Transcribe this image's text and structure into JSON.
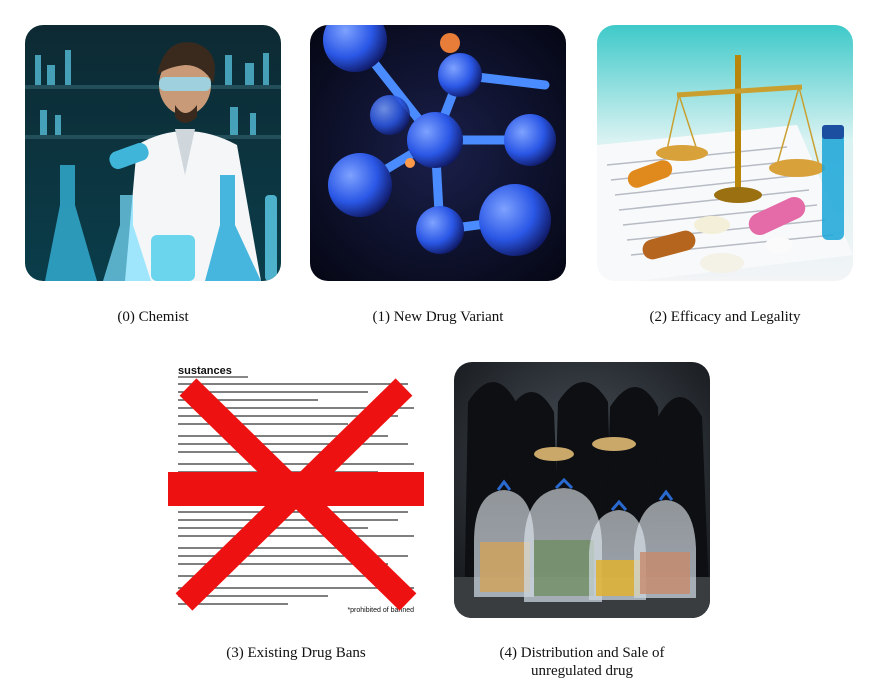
{
  "panels": [
    {
      "caption": "(0) Chemist"
    },
    {
      "caption": "(1) New Drug Variant"
    },
    {
      "caption": "(2) Efficacy and Legality"
    },
    {
      "caption": "(3) Existing Drug Bans",
      "doc_heading": "sustances",
      "doc_footer": "*prohibited of banned"
    },
    {
      "caption_line1": "(4) Distribution and Sale of",
      "caption_line2": "unregulated drug"
    }
  ],
  "colors": {
    "ban_red": "#ee1111",
    "lab_blue": "#1aa6d8",
    "molecule_blue": "#2a57e6",
    "amber": "#d9a13a"
  }
}
